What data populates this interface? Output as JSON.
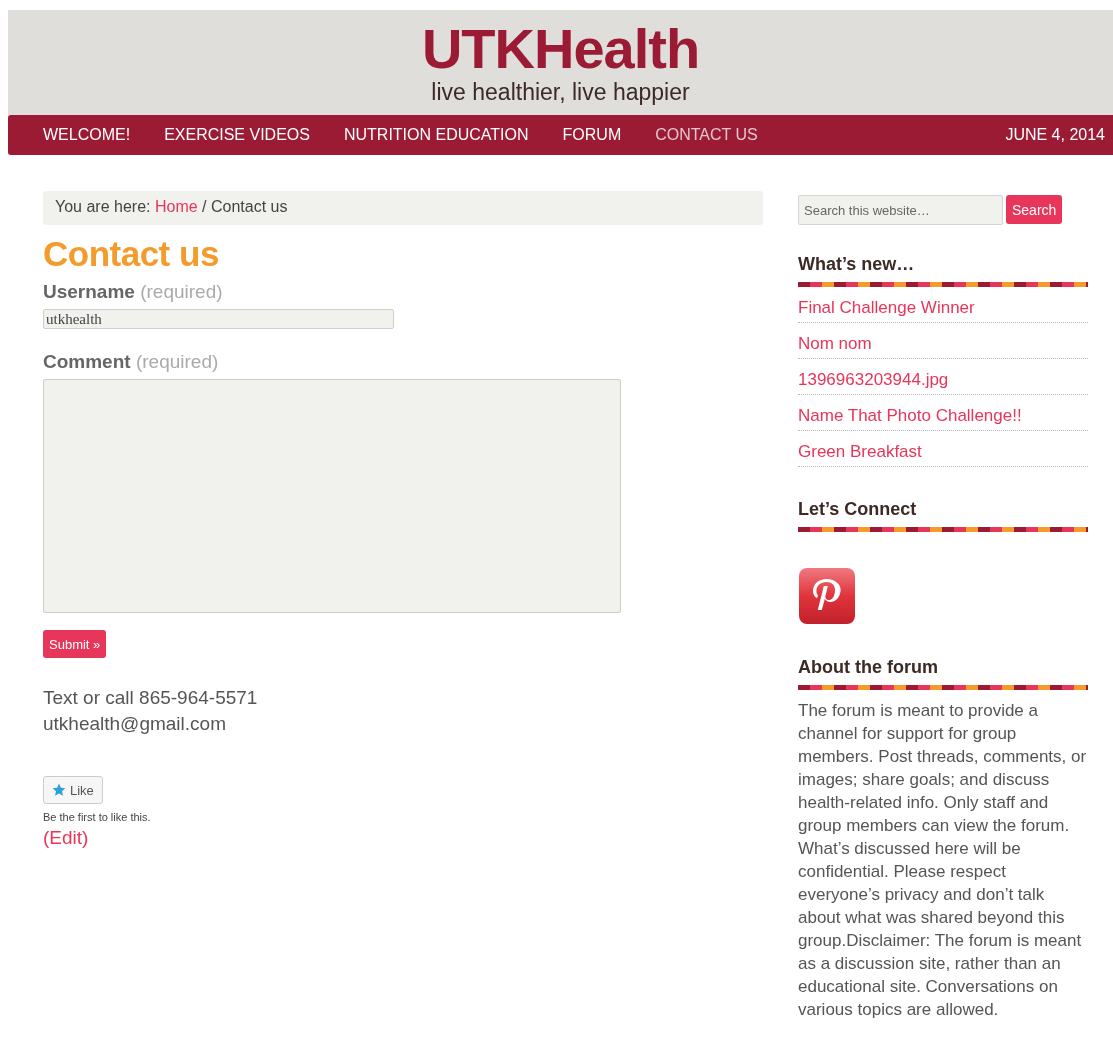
{
  "site": {
    "title": "UTKHealth",
    "tagline": "live healthier, live happier"
  },
  "nav": {
    "items": [
      {
        "label": "WELCOME!",
        "selected": false
      },
      {
        "label": "EXERCISE VIDEOS",
        "selected": false
      },
      {
        "label": "NUTRITION EDUCATION",
        "selected": false
      },
      {
        "label": "FORUM",
        "selected": false
      },
      {
        "label": "CONTACT US",
        "selected": true
      }
    ],
    "date": "JUNE 4, 2014"
  },
  "breadcrumb": {
    "prefix": "You are here:",
    "link": "Home",
    "separator": "/",
    "current": "Contact us"
  },
  "page_title": "Contact us",
  "form": {
    "fields": [
      {
        "label": "Username",
        "note": "(required)",
        "kind": "text",
        "value": "utkhealth"
      },
      {
        "label": "Comment",
        "note": "(required)",
        "kind": "textarea"
      }
    ],
    "submit": "Submit »"
  },
  "contact": [
    "Text or call 865-964-5571",
    "utkhealth@gmail.com"
  ],
  "like": {
    "button": "Like",
    "note": "Be the first to like this."
  },
  "edit_link": "(Edit)",
  "sidebar": {
    "search": {
      "placeholder": "Search this website…",
      "button": "Search"
    },
    "widgets": [
      {
        "kind": "links",
        "title": "What’s new…",
        "items": [
          "Final Challenge Winner",
          "Nom nom",
          "1396963203944.jpg",
          "Name That Photo Challenge!!",
          "Green Breakfast"
        ]
      },
      {
        "kind": "social",
        "title": "Let’s Connect"
      },
      {
        "kind": "text",
        "title": "About the forum",
        "body": "The forum is meant to provide a channel for support for group members. Post threads, comments, or images; share goals; and discuss health-related info. Only staff and group members can view the forum. What’s discussed here will be confidential. Please respect everyone’s privacy and don’t talk about what was shared beyond this group.Disclaimer: The forum is meant as a discussion site, rather than an educational site. Conversations on various topics are allowed."
      }
    ]
  }
}
